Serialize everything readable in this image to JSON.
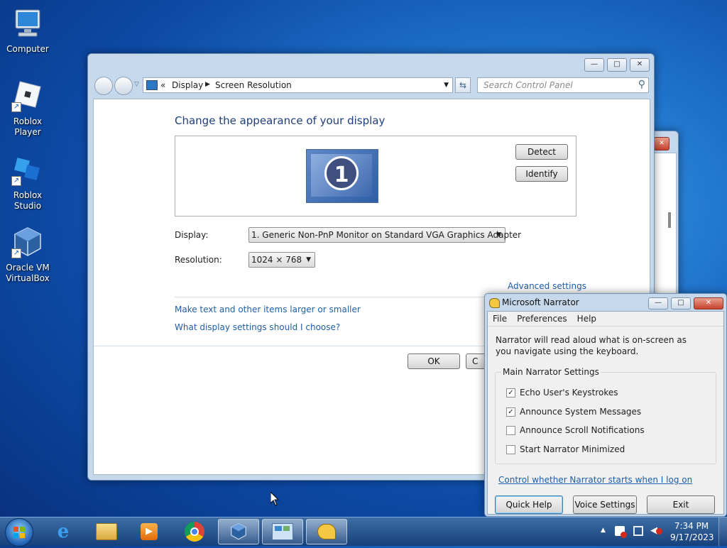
{
  "desktop": {
    "icons": [
      {
        "label": "Computer"
      },
      {
        "label": "Roblox Player"
      },
      {
        "label": "Roblox Studio"
      },
      {
        "label": "Oracle VM\nVirtualBox"
      }
    ]
  },
  "control_panel": {
    "caption_buttons": {
      "minimize": "—",
      "maximize": "□",
      "close": "✕"
    },
    "breadcrumb": {
      "prefix": "«",
      "items": [
        "Display",
        "Screen Resolution"
      ]
    },
    "search": {
      "placeholder": "Search Control Panel"
    },
    "heading": "Change the appearance of your display",
    "monitor": {
      "number": "1"
    },
    "detect_label": "Detect",
    "identify_label": "Identify",
    "display_label": "Display:",
    "display_value": "1. Generic Non-PnP Monitor on Standard VGA Graphics Adapter",
    "resolution_label": "Resolution:",
    "resolution_value": "1024 × 768",
    "advanced_link": "Advanced settings",
    "links": [
      "Make text and other items larger or smaller",
      "What display settings should I choose?"
    ],
    "ok_label": "OK",
    "cancel_label_visible": "C"
  },
  "narrator": {
    "title": "Microsoft Narrator",
    "menu": [
      "File",
      "Preferences",
      "Help"
    ],
    "description": "Narrator will read aloud what is on-screen as you navigate using the keyboard.",
    "group_title": "Main Narrator Settings",
    "options": [
      {
        "label": "Echo User's Keystrokes",
        "checked": true,
        "mark": "✓"
      },
      {
        "label": "Announce System Messages",
        "checked": true,
        "mark": "✓"
      },
      {
        "label": "Announce Scroll Notifications",
        "checked": false,
        "mark": ""
      },
      {
        "label": "Start Narrator Minimized",
        "checked": false,
        "mark": ""
      }
    ],
    "startup_link": "Control whether Narrator starts when I log on",
    "buttons": {
      "quick_help": "Quick Help",
      "voice_settings": "Voice Settings",
      "exit": "Exit"
    }
  },
  "taskbar": {
    "clock_time": "7:34 PM",
    "clock_date": "9/17/2023",
    "tray_arrow": "▲"
  },
  "colors": {
    "link": "#1e5ea7",
    "heading": "#1e3f7a",
    "taskbar": "#17407a"
  }
}
